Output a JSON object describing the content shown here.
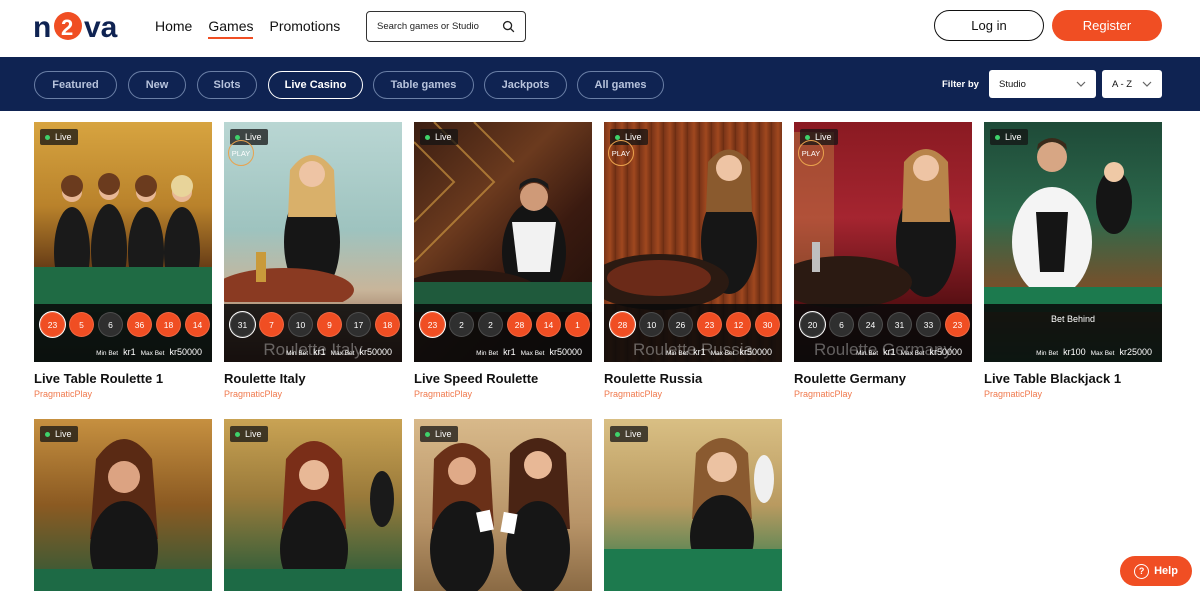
{
  "header": {
    "logo_text": "nova",
    "nav": [
      "Home",
      "Games",
      "Promotions"
    ],
    "active_nav": "Games",
    "search_placeholder": "Search games or Studio",
    "login_label": "Log in",
    "register_label": "Register"
  },
  "filters": {
    "chips": [
      "Featured",
      "New",
      "Slots",
      "Live Casino",
      "Table games",
      "Jackpots",
      "All games"
    ],
    "active_chip": "Live Casino",
    "filter_by_label": "Filter by",
    "studio_select": "Studio",
    "sort_select": "A - Z"
  },
  "games": [
    {
      "title": "Live Table Roulette 1",
      "provider": "PragmaticPlay",
      "live": "Live",
      "play_badge": "",
      "results": [
        "23",
        "5",
        "6",
        "36",
        "18",
        "14"
      ],
      "colors": [
        "red",
        "red",
        "black",
        "red",
        "red",
        "red"
      ],
      "min_bet_label": "Min Bet",
      "min_bet": "kr1",
      "max_bet_label": "Max Bet",
      "max_bet": "kr50000",
      "watermark": "",
      "bet_behind": ""
    },
    {
      "title": "Roulette Italy",
      "provider": "PragmaticPlay",
      "live": "Live",
      "play_badge": "PLAY",
      "results": [
        "31",
        "7",
        "10",
        "9",
        "17",
        "18"
      ],
      "colors": [
        "black",
        "red",
        "black",
        "red",
        "black",
        "red"
      ],
      "min_bet_label": "Min Bet",
      "min_bet": "kr1",
      "max_bet_label": "Max Bet",
      "max_bet": "kr50000",
      "watermark": "Roulette Italy",
      "bet_behind": ""
    },
    {
      "title": "Live Speed Roulette",
      "provider": "PragmaticPlay",
      "live": "Live",
      "play_badge": "",
      "results": [
        "23",
        "2",
        "2",
        "28",
        "14",
        "1"
      ],
      "colors": [
        "red",
        "black",
        "black",
        "red",
        "red",
        "red"
      ],
      "min_bet_label": "Min Bet",
      "min_bet": "kr1",
      "max_bet_label": "Max Bet",
      "max_bet": "kr50000",
      "watermark": "",
      "bet_behind": ""
    },
    {
      "title": "Roulette Russia",
      "provider": "PragmaticPlay",
      "live": "Live",
      "play_badge": "PLAY",
      "results": [
        "28",
        "10",
        "26",
        "23",
        "12",
        "30"
      ],
      "colors": [
        "red",
        "black",
        "black",
        "red",
        "red",
        "red"
      ],
      "min_bet_label": "Min Bet",
      "min_bet": "kr1",
      "max_bet_label": "Max Bet",
      "max_bet": "kr50000",
      "watermark": "Roulette Russia",
      "bet_behind": ""
    },
    {
      "title": "Roulette Germany",
      "provider": "PragmaticPlay",
      "live": "Live",
      "play_badge": "PLAY",
      "results": [
        "20",
        "6",
        "24",
        "31",
        "33",
        "23"
      ],
      "colors": [
        "black",
        "black",
        "black",
        "black",
        "black",
        "red"
      ],
      "min_bet_label": "Min Bet",
      "min_bet": "kr1",
      "max_bet_label": "Max Bet",
      "max_bet": "kr50000",
      "watermark": "Roulette Germany",
      "bet_behind": ""
    },
    {
      "title": "Live Table Blackjack 1",
      "provider": "PragmaticPlay",
      "live": "Live",
      "play_badge": "",
      "results": [],
      "colors": [],
      "min_bet_label": "Min Bet",
      "min_bet": "kr100",
      "max_bet_label": "Max Bet",
      "max_bet": "kr25000",
      "watermark": "",
      "bet_behind": "Bet Behind"
    },
    {
      "title": "",
      "provider": "",
      "live": "Live",
      "play_badge": "",
      "results": [],
      "colors": []
    },
    {
      "title": "",
      "provider": "",
      "live": "Live",
      "play_badge": "",
      "results": [],
      "colors": []
    },
    {
      "title": "",
      "provider": "",
      "live": "Live",
      "play_badge": "",
      "results": [],
      "colors": []
    },
    {
      "title": "",
      "provider": "",
      "live": "Live",
      "play_badge": "",
      "results": [],
      "colors": []
    }
  ],
  "help_label": "Help",
  "icons": {
    "search": "search-icon",
    "chevron": "chevron-down-icon",
    "help": "question-icon"
  },
  "colors": {
    "accent": "#f04e23",
    "navy": "#0f2352"
  }
}
